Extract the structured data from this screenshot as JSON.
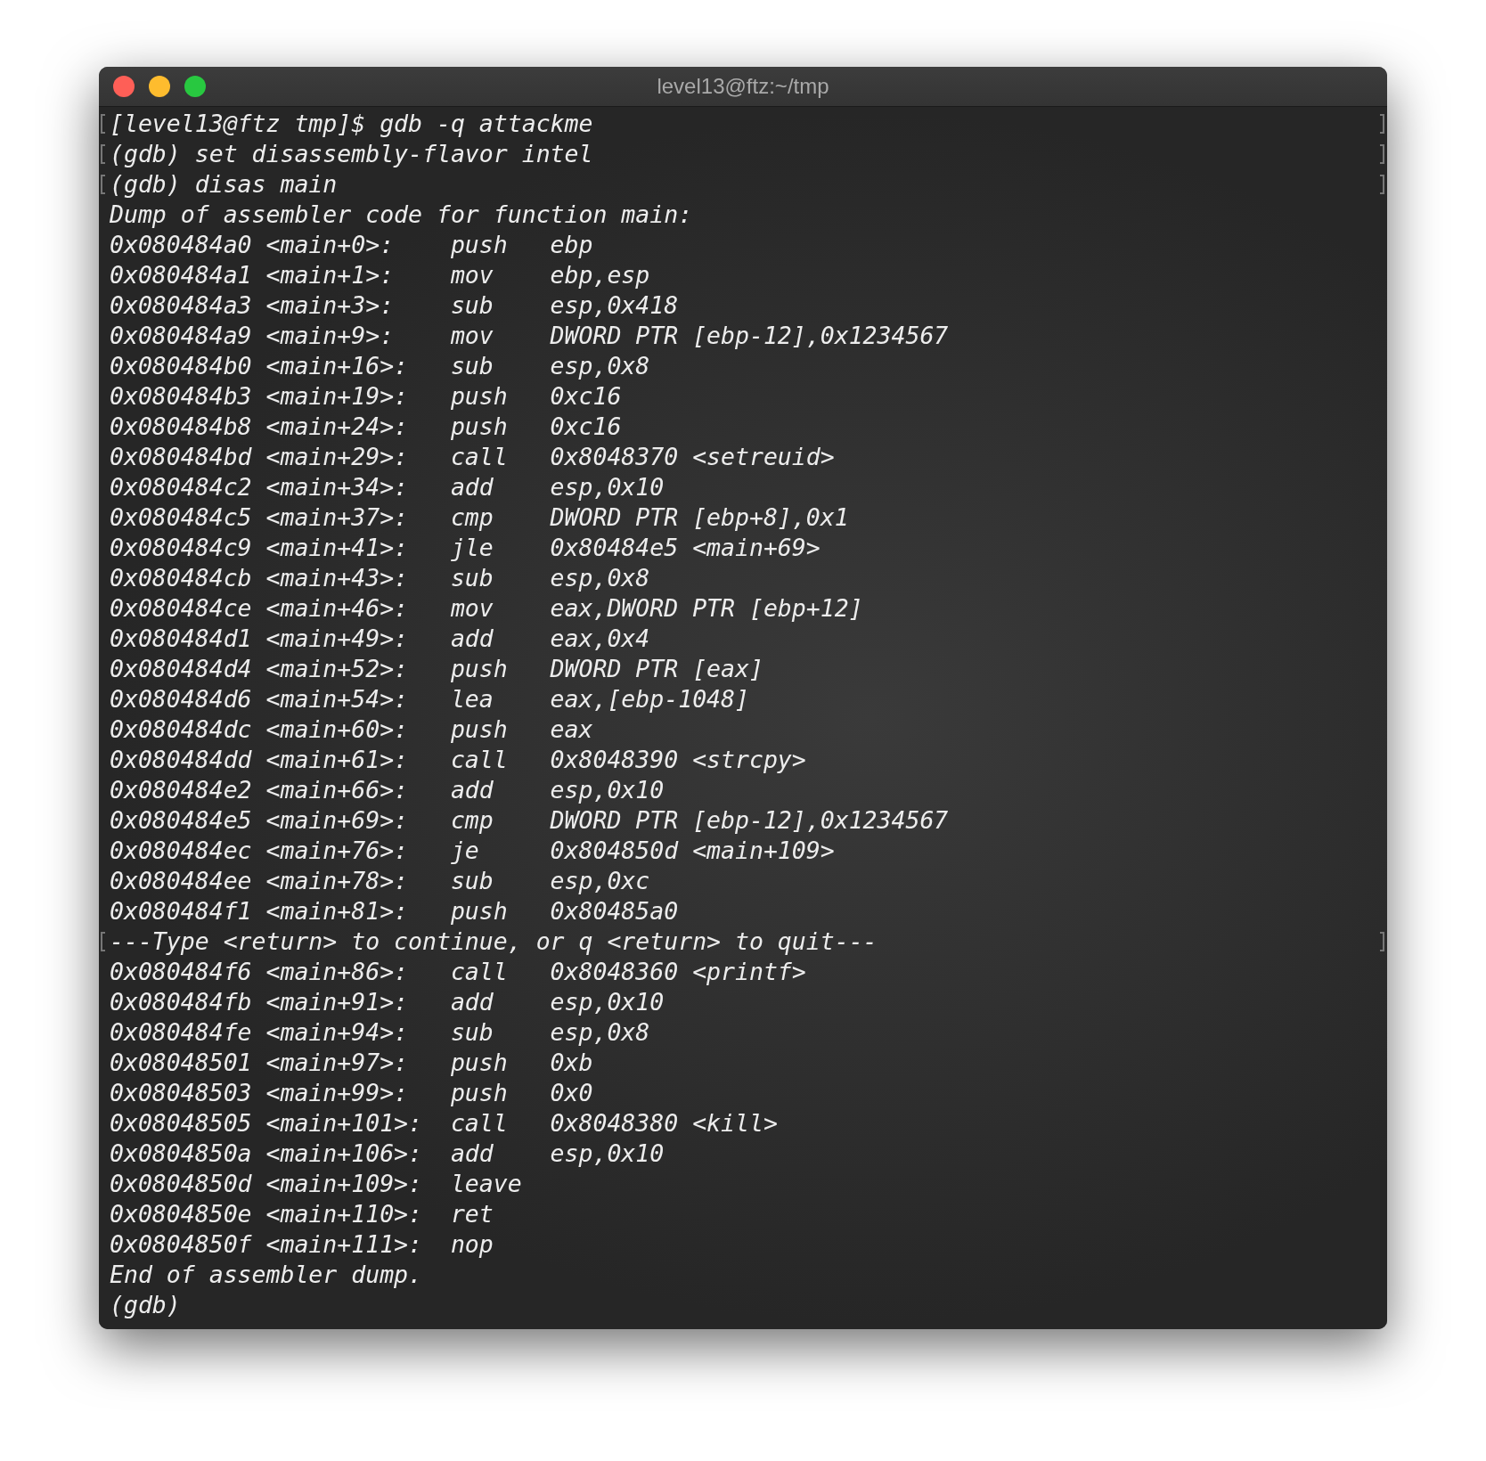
{
  "window": {
    "title": "level13@ftz:~/tmp",
    "buttons": [
      {
        "kind": "close"
      },
      {
        "kind": "minimize"
      },
      {
        "kind": "zoom"
      }
    ]
  },
  "terminal": {
    "lines": [
      {
        "text": "[level13@ftz tmp]$ gdb -q attackme",
        "marked": true
      },
      {
        "text": "(gdb) set disassembly-flavor intel",
        "marked": true
      },
      {
        "text": "(gdb) disas main",
        "marked": true
      },
      {
        "text": "Dump of assembler code for function main:",
        "marked": false
      },
      {
        "text": "0x080484a0 <main+0>:    push   ebp",
        "marked": false
      },
      {
        "text": "0x080484a1 <main+1>:    mov    ebp,esp",
        "marked": false
      },
      {
        "text": "0x080484a3 <main+3>:    sub    esp,0x418",
        "marked": false
      },
      {
        "text": "0x080484a9 <main+9>:    mov    DWORD PTR [ebp-12],0x1234567",
        "marked": false
      },
      {
        "text": "0x080484b0 <main+16>:   sub    esp,0x8",
        "marked": false
      },
      {
        "text": "0x080484b3 <main+19>:   push   0xc16",
        "marked": false
      },
      {
        "text": "0x080484b8 <main+24>:   push   0xc16",
        "marked": false
      },
      {
        "text": "0x080484bd <main+29>:   call   0x8048370 <setreuid>",
        "marked": false
      },
      {
        "text": "0x080484c2 <main+34>:   add    esp,0x10",
        "marked": false
      },
      {
        "text": "0x080484c5 <main+37>:   cmp    DWORD PTR [ebp+8],0x1",
        "marked": false
      },
      {
        "text": "0x080484c9 <main+41>:   jle    0x80484e5 <main+69>",
        "marked": false
      },
      {
        "text": "0x080484cb <main+43>:   sub    esp,0x8",
        "marked": false
      },
      {
        "text": "0x080484ce <main+46>:   mov    eax,DWORD PTR [ebp+12]",
        "marked": false
      },
      {
        "text": "0x080484d1 <main+49>:   add    eax,0x4",
        "marked": false
      },
      {
        "text": "0x080484d4 <main+52>:   push   DWORD PTR [eax]",
        "marked": false
      },
      {
        "text": "0x080484d6 <main+54>:   lea    eax,[ebp-1048]",
        "marked": false
      },
      {
        "text": "0x080484dc <main+60>:   push   eax",
        "marked": false
      },
      {
        "text": "0x080484dd <main+61>:   call   0x8048390 <strcpy>",
        "marked": false
      },
      {
        "text": "0x080484e2 <main+66>:   add    esp,0x10",
        "marked": false
      },
      {
        "text": "0x080484e5 <main+69>:   cmp    DWORD PTR [ebp-12],0x1234567",
        "marked": false
      },
      {
        "text": "0x080484ec <main+76>:   je     0x804850d <main+109>",
        "marked": false
      },
      {
        "text": "0x080484ee <main+78>:   sub    esp,0xc",
        "marked": false
      },
      {
        "text": "0x080484f1 <main+81>:   push   0x80485a0",
        "marked": false
      },
      {
        "text": "---Type <return> to continue, or q <return> to quit---",
        "marked": true
      },
      {
        "text": "0x080484f6 <main+86>:   call   0x8048360 <printf>",
        "marked": false
      },
      {
        "text": "0x080484fb <main+91>:   add    esp,0x10",
        "marked": false
      },
      {
        "text": "0x080484fe <main+94>:   sub    esp,0x8",
        "marked": false
      },
      {
        "text": "0x08048501 <main+97>:   push   0xb",
        "marked": false
      },
      {
        "text": "0x08048503 <main+99>:   push   0x0",
        "marked": false
      },
      {
        "text": "0x08048505 <main+101>:  call   0x8048380 <kill>",
        "marked": false
      },
      {
        "text": "0x0804850a <main+106>:  add    esp,0x10",
        "marked": false
      },
      {
        "text": "0x0804850d <main+109>:  leave",
        "marked": false
      },
      {
        "text": "0x0804850e <main+110>:  ret",
        "marked": false
      },
      {
        "text": "0x0804850f <main+111>:  nop",
        "marked": false
      },
      {
        "text": "End of assembler dump.",
        "marked": false
      },
      {
        "text": "(gdb)",
        "marked": false
      }
    ]
  }
}
